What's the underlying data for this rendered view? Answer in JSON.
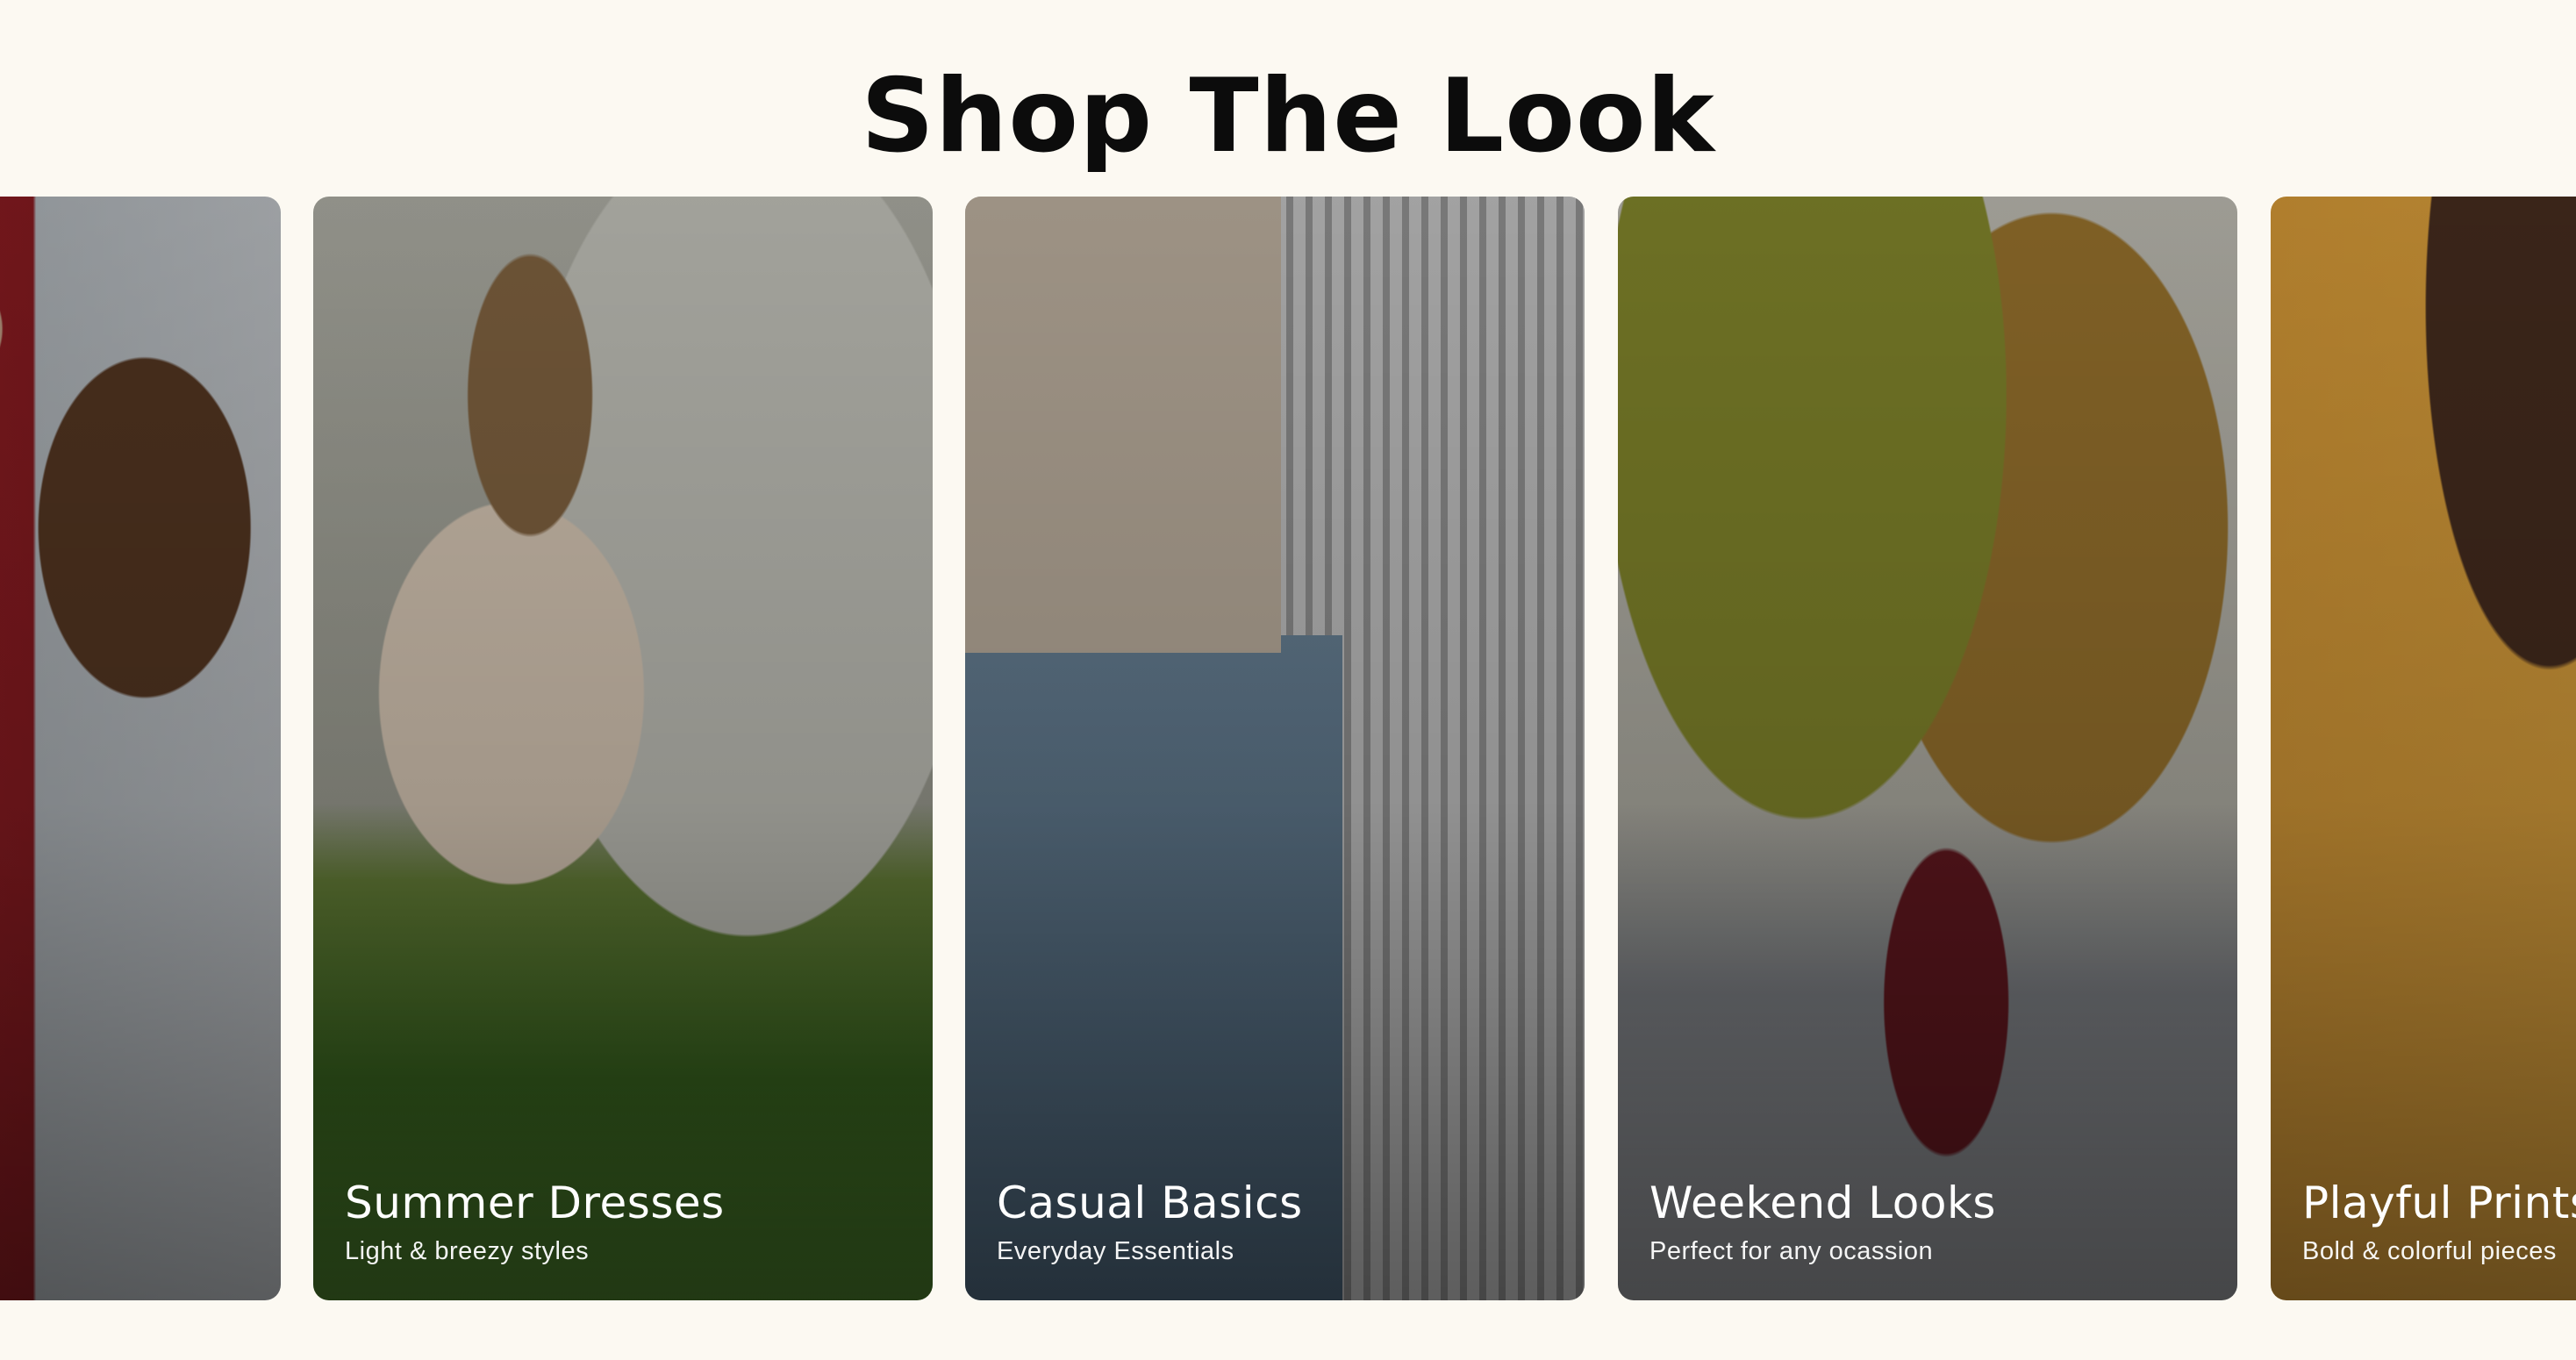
{
  "page": {
    "title": "Shop The Look"
  },
  "colors": {
    "background": "#fcf9f2",
    "title": "#0c0c0c",
    "caption": "#ffffff"
  },
  "cards": [
    {
      "id": "red-dress",
      "title": "",
      "subtitle": ""
    },
    {
      "id": "summer",
      "title": "Summer Dresses",
      "subtitle": "Light & breezy styles"
    },
    {
      "id": "casual",
      "title": "Casual Basics",
      "subtitle": "Everyday Essentials"
    },
    {
      "id": "weekend",
      "title": "Weekend Looks",
      "subtitle": "Perfect for any ocassion"
    },
    {
      "id": "playful",
      "title": "Playful Prints",
      "subtitle": "Bold & colorful pieces"
    }
  ]
}
